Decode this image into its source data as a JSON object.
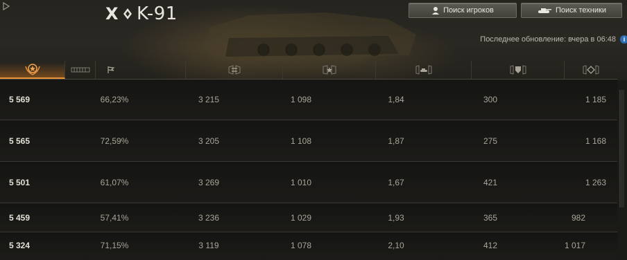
{
  "title": {
    "tier": "X",
    "name": "K-91"
  },
  "toolbar": {
    "players_label": "Поиск игроков",
    "vehicles_label": "Поиск техники"
  },
  "update_text": "Последнее обновление: вчера в 06:48",
  "columns": [
    {
      "icon": "rating-medal-icon",
      "active": true
    },
    {
      "icon": "battles-bars-icon",
      "active": false
    },
    {
      "icon": "victory-flag-icon",
      "active": false
    },
    {
      "icon": "damage-exchange-icon",
      "active": false
    },
    {
      "icon": "experience-star-icon",
      "active": false
    },
    {
      "icon": "frags-tank-icon",
      "active": false
    },
    {
      "icon": "spotting-shield-icon",
      "active": false
    },
    {
      "icon": "blocked-armor-icon",
      "active": false
    }
  ],
  "rows": [
    [
      "5 569",
      "66,23%",
      "3 215",
      "1 098",
      "1,84",
      "300",
      "1 185"
    ],
    [
      "5 565",
      "72,59%",
      "3 205",
      "1 108",
      "1,87",
      "275",
      "1 168"
    ],
    [
      "5 501",
      "61,07%",
      "3 269",
      "1 010",
      "1,67",
      "421",
      "1 263"
    ],
    [
      "5 459",
      "57,41%",
      "3 236",
      "1 029",
      "1,93",
      "365",
      "982"
    ],
    [
      "5 324",
      "71,15%",
      "3 119",
      "1 078",
      "2,10",
      "412",
      "1 017"
    ]
  ],
  "colors": {
    "accent": "#e8903a",
    "info": "#2f6fb6"
  }
}
